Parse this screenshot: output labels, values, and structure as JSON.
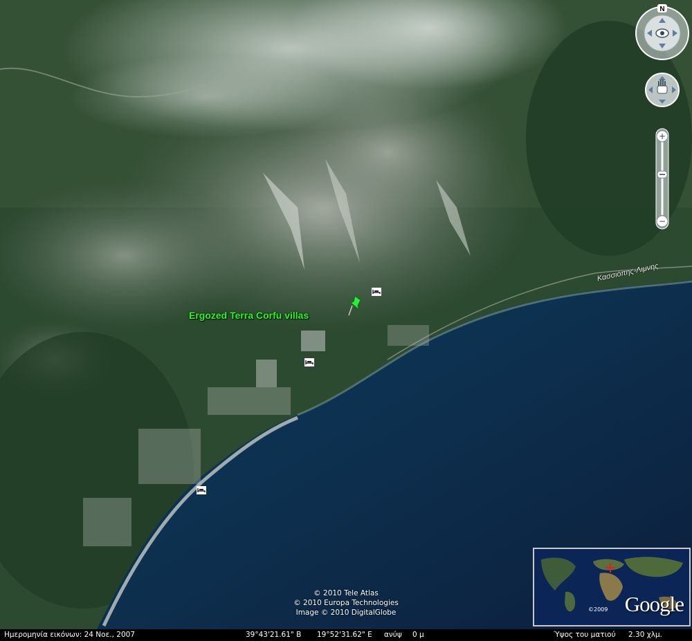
{
  "placemark": {
    "label": "Ergozed Terra Corfu villas",
    "icon": "pushpin-icon",
    "color": "#2eea3a"
  },
  "road_label": "Κασσιόπης-Λιμνης",
  "hotel_icons": [
    "hotel-bed-icon",
    "hotel-bed-icon",
    "hotel-bed-icon"
  ],
  "credits": [
    "© 2010 Tele Atlas",
    "© 2010 Europa Technologies",
    "Image © 2010 DigitalGlobe"
  ],
  "navigation": {
    "compass_north": "N",
    "look_control": "eye-icon",
    "move_control": "hand-icon",
    "zoom_in": "+",
    "zoom_out": "−",
    "zoom_level": 0.45
  },
  "overview_map": {
    "logo": "Google",
    "year": "©2009"
  },
  "status_bar": {
    "imagery_date": "Ημερομηνία εικόνων: 24 Νοε., 2007",
    "latitude": "39°43'21.61\" Β",
    "longitude": "19°52'31.62\" Ε",
    "elevation_label": "ανύψ",
    "elevation_value": "0 μ",
    "eye_alt_label": "Ύψος του ματιού",
    "eye_alt_value": "2.30 χλμ."
  },
  "colors": {
    "sea": "#0d2a45",
    "land": "#2e4a32",
    "label_green": "#1eff1e",
    "statusbar": "#000000"
  }
}
